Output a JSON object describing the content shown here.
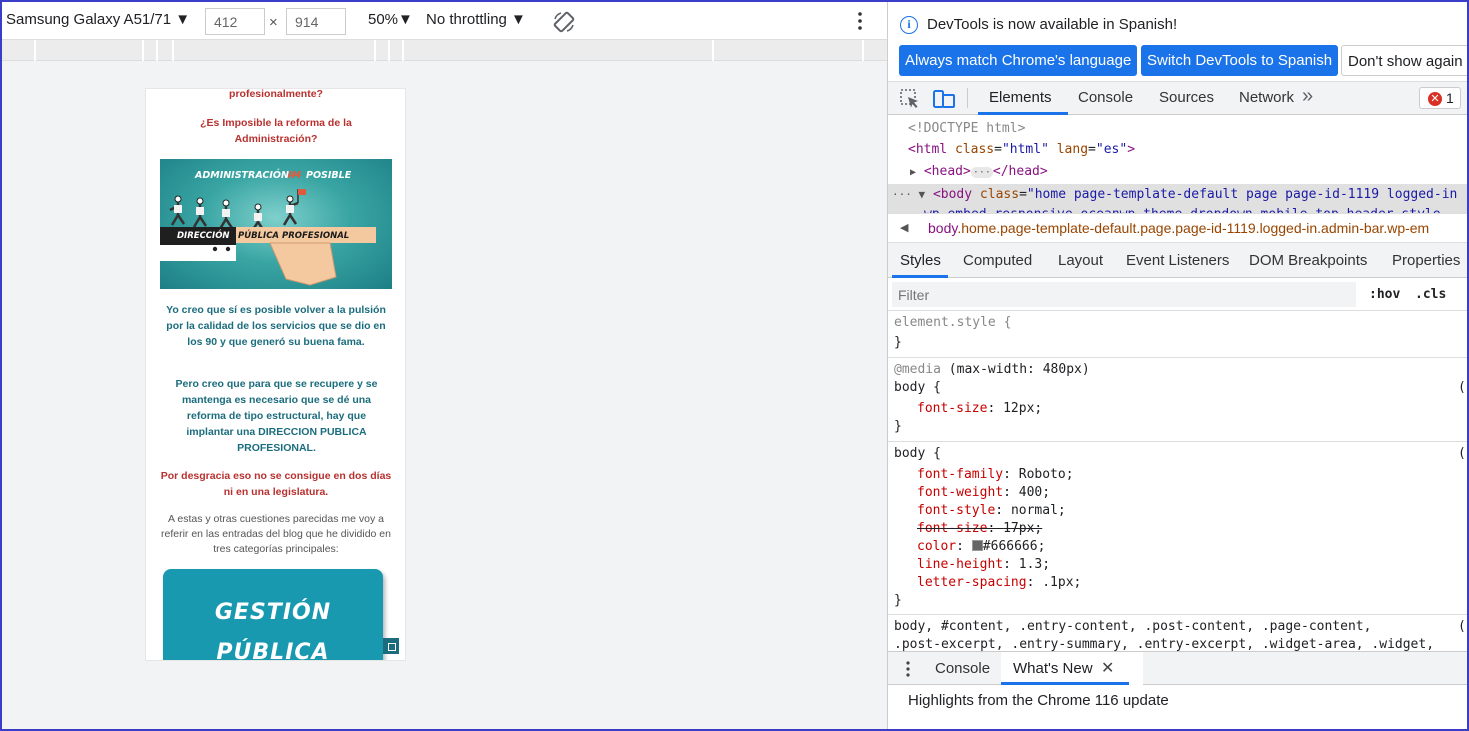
{
  "device_toolbar": {
    "device": "Samsung Galaxy A51/71",
    "width": "412",
    "height": "914",
    "times": "×",
    "zoom": "50%",
    "throttling": "No throttling"
  },
  "phone_page": {
    "p1": "profesionalmente?",
    "p2": "¿Es Imposible la reforma de la Administración?",
    "image_title_a": "ADMINISTRACIÓN",
    "image_title_strike": "IM",
    "image_title_b": "POSIBLE",
    "image_sub_a": "DIRECCIÓN",
    "image_sub_b": "PÚBLICA PROFESIONAL",
    "p3": "Yo creo que sí es posible volver a la pulsión por la calidad de los servicios que se dio en los 90 y que generó su buena fama.",
    "p4": "Pero creo que para que se recupere y se mantenga es necesario que se dé una reforma de tipo estructural, hay que implantar una DIRECCION PUBLICA PROFESIONAL.",
    "p5": "Por desgracia eso no se consigue en dos días ni en una legislatura.",
    "p6": "A estas y otras cuestiones parecidas me voy a referir en las entradas del blog que he dividido en tres categorías principales:",
    "card_line1": "GESTIÓN",
    "card_line2": "PÚBLICA"
  },
  "devtools": {
    "info_text": "DevTools is now available in Spanish!",
    "btn_match": "Always match Chrome's language",
    "btn_switch": "Switch DevTools to Spanish",
    "btn_dont": "Don't show again",
    "tabs": [
      "Elements",
      "Console",
      "Sources",
      "Network"
    ],
    "more_tabs": "»",
    "error_count": "1",
    "error_glyph": "✕",
    "dom": {
      "doctype": "<!DOCTYPE html>",
      "html_open": "<html",
      "html_class_attr": "class",
      "html_class_val": "\"html\"",
      "html_lang_attr": "lang",
      "html_lang_val": "\"es\"",
      "html_close": ">",
      "head": "<head>",
      "head_ellipsis": "···",
      "head_close": "</head>",
      "body_prefix": "··· ▼",
      "body_open": "<body",
      "body_class_attr": "class",
      "body_class_val": "\"home page-template-default page page-id-1119 logged-in",
      "body_line2": "wp-embed-responsive oceanwp-theme dropdown-mobile top-header-style"
    },
    "breadcrumb_tag": "body",
    "breadcrumb_rest": ".home.page-template-default.page.page-id-1119.logged-in.admin-bar.wp-em",
    "style_tabs": [
      "Styles",
      "Computed",
      "Layout",
      "Event Listeners",
      "DOM Breakpoints",
      "Properties"
    ],
    "filter_placeholder": "Filter",
    "hov": ":hov",
    "cls": ".cls",
    "rules": {
      "element_style": "element.style {",
      "close": "}",
      "media_kw": "@media",
      "media_cond": " (max-width: 480px)",
      "body_sel": "body {",
      "fs_prop": "font-size",
      "fs_val": "12px;",
      "paren": "(",
      "ff_prop": "font-family",
      "ff_val": "Roboto;",
      "fw_prop": "font-weight",
      "fw_val": "400;",
      "fst_prop": "font-style",
      "fst_val": "normal;",
      "fs2_prop": "font-size",
      "fs2_val": "17px;",
      "color_prop": "color",
      "color_val": "#666666;",
      "color_swatch": "#666666",
      "lh_prop": "line-height",
      "lh_val": "1.3;",
      "ls_prop": "letter-spacing",
      "ls_val": ".1px;",
      "multi_sel_1": "body, #content, .entry-content, .post-content, .page-content,",
      "multi_sel_2": ".post-excerpt, .entry-summary, .entry-excerpt, .widget-area, .widget,"
    },
    "drawer_tabs": [
      "Console",
      "What's New"
    ],
    "drawer_close": "✕",
    "drawer_text": "Highlights from the Chrome 116 update"
  },
  "colors": {
    "accent": "#1a73e8",
    "frame": "#3a3dc8",
    "phone_red": "#b8312f",
    "phone_teal": "#1b6d7e"
  }
}
